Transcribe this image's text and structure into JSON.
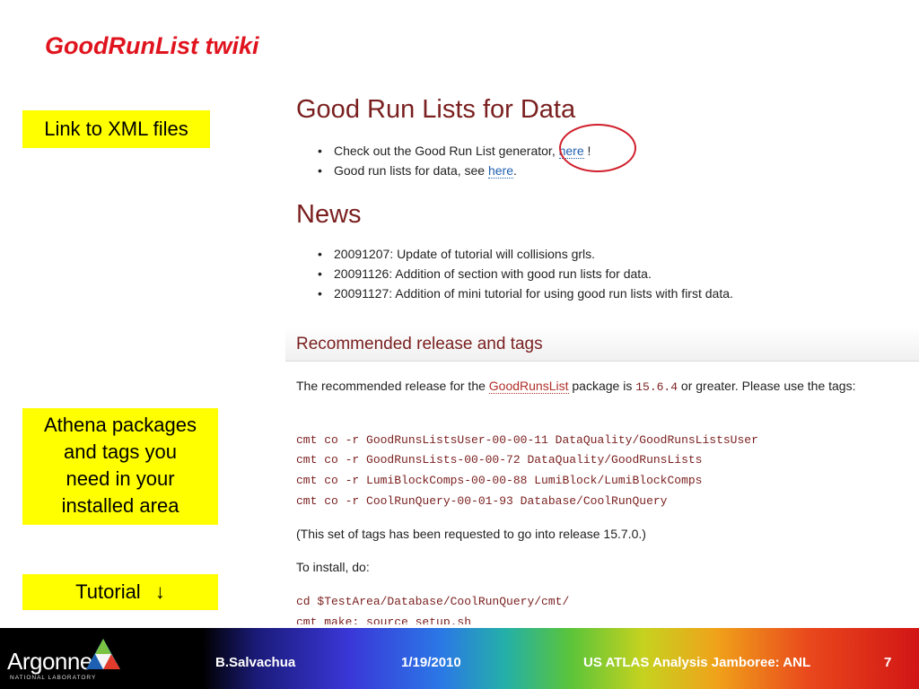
{
  "slide": {
    "title": "GoodRunList twiki"
  },
  "notes": {
    "xml": "Link to XML files",
    "athena": [
      "Athena packages",
      "and tags you",
      "need in your",
      "installed area"
    ],
    "tutorial": "Tutorial",
    "tutorial_arrow": "↓"
  },
  "wiki": {
    "grl_heading": "Good Run Lists for Data",
    "grl_items": [
      {
        "before": "Check out the Good Run List generator, ",
        "link": "here",
        "after": " !"
      },
      {
        "before": "Good run lists for data, see ",
        "link": "here",
        "after": "."
      }
    ],
    "news_heading": "News",
    "news_items": [
      "20091207: Update of tutorial will collisions grls.",
      "20091126: Addition of section with good run lists for data.",
      "20091127: Addition of mini tutorial for using good run lists with first data."
    ],
    "section_title": "Recommended release and tags",
    "release": {
      "before": "The recommended release for the ",
      "link": "GoodRunsList",
      "middle": " package is ",
      "version": "15.6.4",
      "after": " or greater. Please use the tags:"
    },
    "code_tags": [
      "cmt co -r GoodRunsListsUser-00-00-11 DataQuality/GoodRunsListsUser",
      "cmt co -r GoodRunsLists-00-00-72 DataQuality/GoodRunsLists",
      "cmt co -r LumiBlockComps-00-00-88 LumiBlock/LumiBlockComps",
      "cmt co -r CoolRunQuery-00-01-93 Database/CoolRunQuery"
    ],
    "tags_note": "(This set of tags has been requested to go into release 15.7.0.)",
    "install_note": "To install, do:",
    "code_install": [
      "cd $TestArea/Database/CoolRunQuery/cmt/",
      "cmt make; source setup.sh"
    ]
  },
  "footer": {
    "logo": "Argonne",
    "logo_sub": "NATIONAL LABORATORY",
    "author": "B.Salvachua",
    "date": "1/19/2010",
    "event": "US ATLAS Analysis Jamboree: ANL",
    "page": "7"
  },
  "colors": {
    "title": "#e0141e",
    "note_bg": "#ffff00",
    "wiki_heading": "#7a1f1f",
    "link": "#1f5fb0",
    "circle": "#d0202c"
  }
}
